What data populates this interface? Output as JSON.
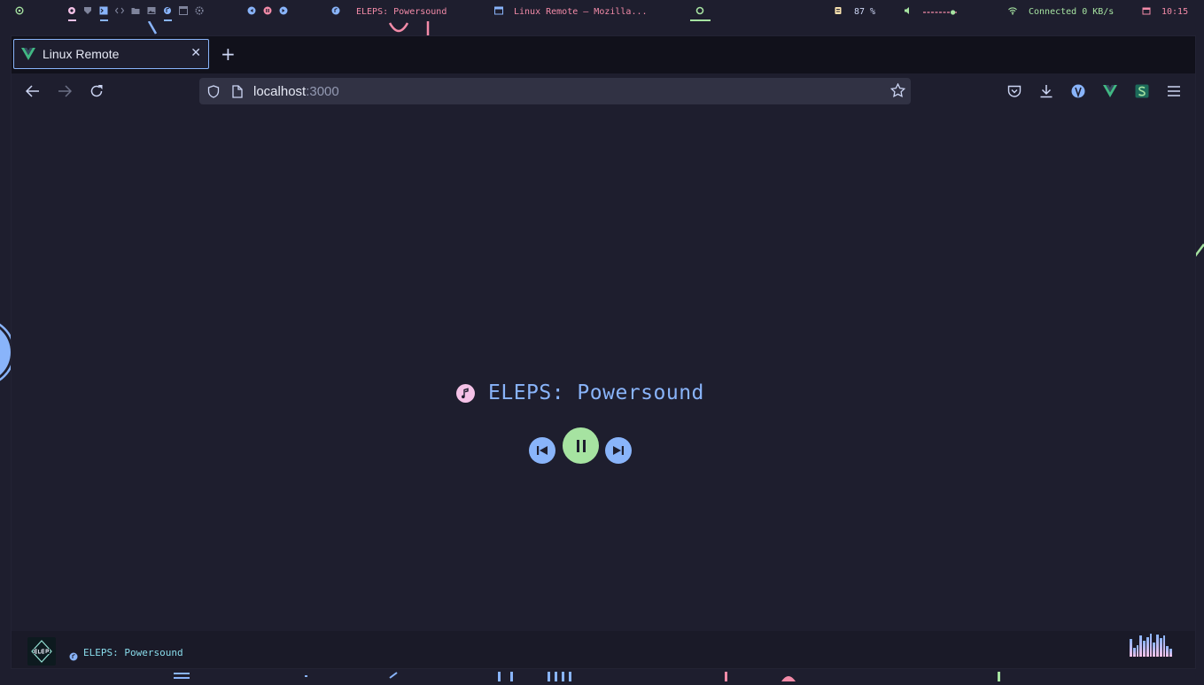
{
  "topbar": {
    "media_title": "ELEPS: Powersound",
    "window_title": "Linux Remote — Mozilla...",
    "brightness": "87 %",
    "volume_level": 0.85,
    "network": "Connected 0 KB/s",
    "clock": "10:15"
  },
  "browser": {
    "tab_title": "Linux Remote",
    "url_host": "localhost",
    "url_port": ":3000"
  },
  "player": {
    "track_title": "ELEPS: Powersound"
  },
  "statusbar": {
    "song_text": "ELEPS: Powersound"
  },
  "colors": {
    "background": "#1e1e2e",
    "accent_blue": "#89b4fa",
    "accent_green": "#a6e3a1",
    "accent_pink": "#f5c2e7",
    "accent_red": "#f38ba8"
  }
}
